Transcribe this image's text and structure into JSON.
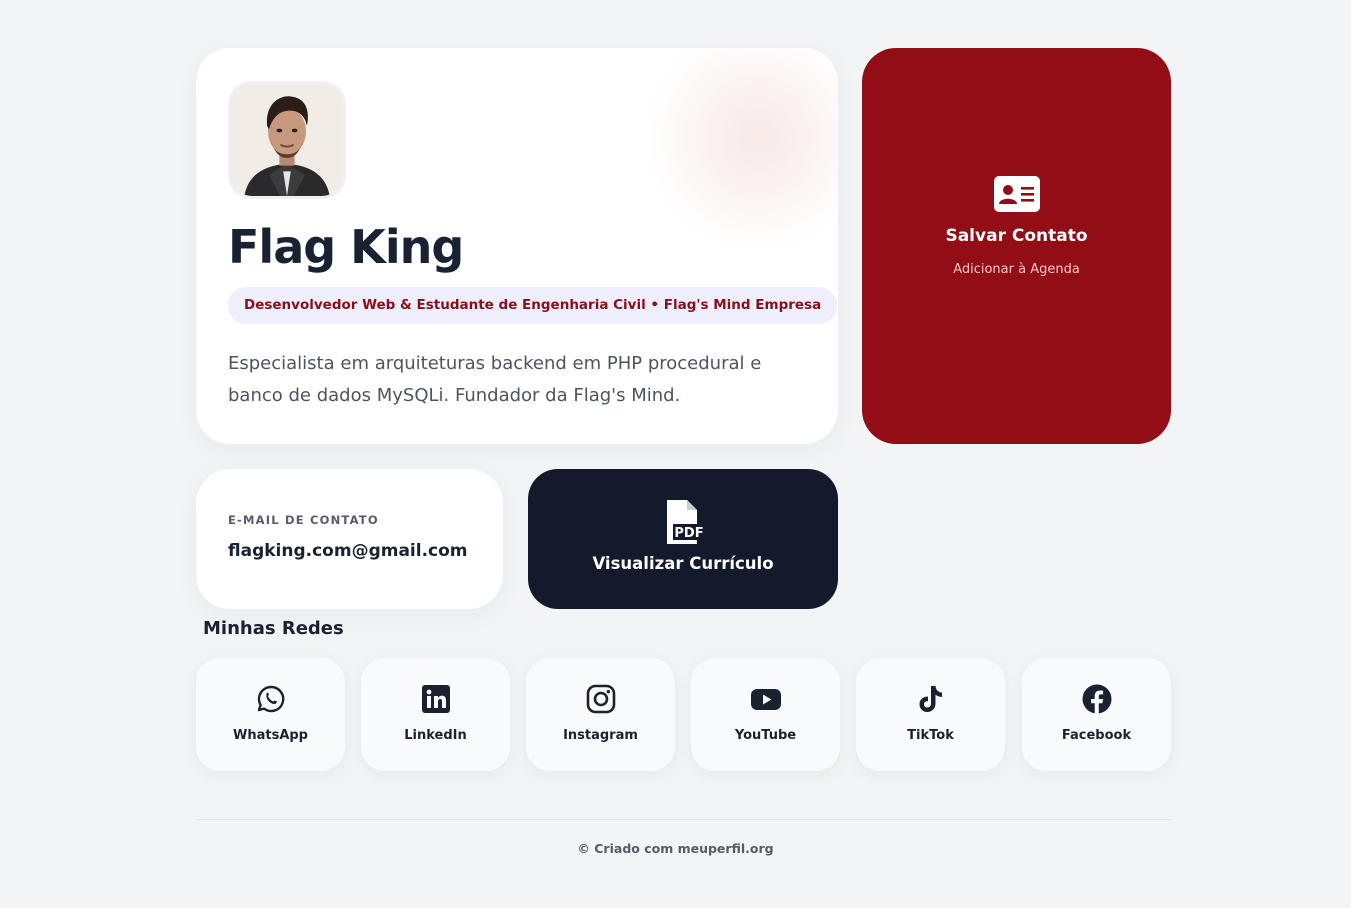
{
  "profile": {
    "name": "Flag King",
    "role": "Desenvolvedor Web & Estudante de Engenharia Civil • Flag's Mind Empresa",
    "bio": "Especialista em arquiteturas backend em PHP procedural e banco de dados MySQLi. Fundador da Flag's Mind.",
    "avatar_icon": "portrait-photo"
  },
  "save_contact": {
    "title": "Salvar Contato",
    "subtitle": "Adicionar à Agenda",
    "icon": "contact-card-icon"
  },
  "email": {
    "label": "E-MAIL DE CONTATO",
    "value": "flagking.com@gmail.com"
  },
  "resume": {
    "title": "Visualizar Currículo",
    "icon": "pdf-file-icon"
  },
  "social": {
    "title": "Minhas Redes",
    "items": [
      {
        "label": "WhatsApp",
        "icon": "whatsapp-icon"
      },
      {
        "label": "LinkedIn",
        "icon": "linkedin-icon"
      },
      {
        "label": "Instagram",
        "icon": "instagram-icon"
      },
      {
        "label": "YouTube",
        "icon": "youtube-icon"
      },
      {
        "label": "TikTok",
        "icon": "tiktok-icon"
      },
      {
        "label": "Facebook",
        "icon": "facebook-icon"
      }
    ]
  },
  "footer": "© Criado com meuperfil.org",
  "colors": {
    "accent_red": "#930d16",
    "dark_navy": "#121a2b",
    "background": "#f3f4f6"
  }
}
